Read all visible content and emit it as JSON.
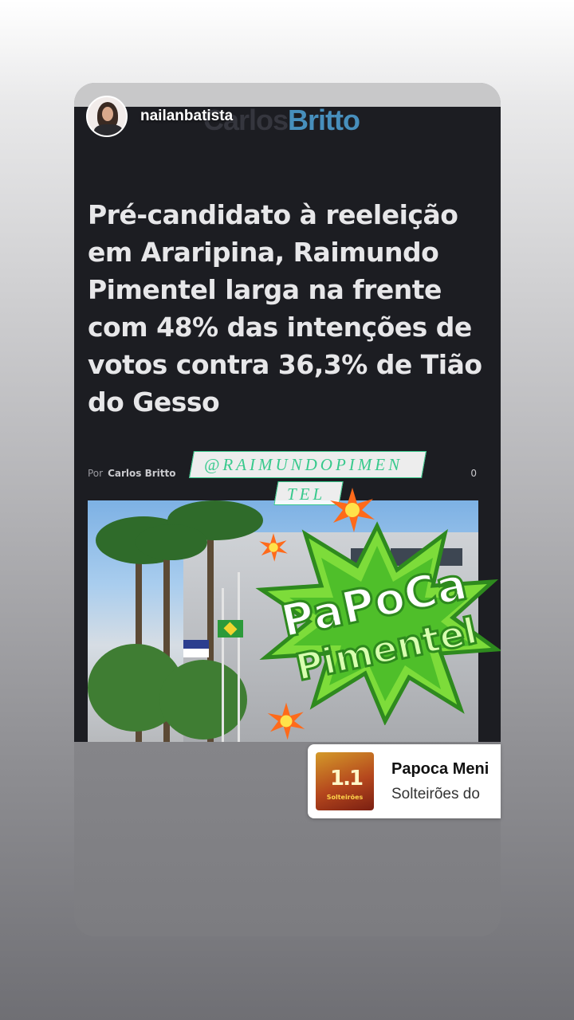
{
  "story": {
    "username": "nailanbatista"
  },
  "post": {
    "site_logo_a": "Carlos",
    "site_logo_b": "Britto",
    "headline": "Pré-candidato à reeleição em Araripina, Raimundo Pimentel larga na frente com 48% das intenções de votos contra 36,3% de Tião do Gesso",
    "byline_prefix": "Por",
    "byline_author": "Carlos Britto",
    "comment_count": "0"
  },
  "stickers": {
    "mention_line1": "@RAIMUNDOPIMEN",
    "mention_line2": "TEL",
    "burst_line1": "PaPoCa",
    "burst_line2": "Pimentel",
    "accent_green": "#7ddc3a",
    "dark_green": "#2e8a1e"
  },
  "music": {
    "title": "Papoca Meni",
    "artist": "Solteirões do",
    "album_number": "1.1",
    "album_brand": "Solteirões"
  }
}
